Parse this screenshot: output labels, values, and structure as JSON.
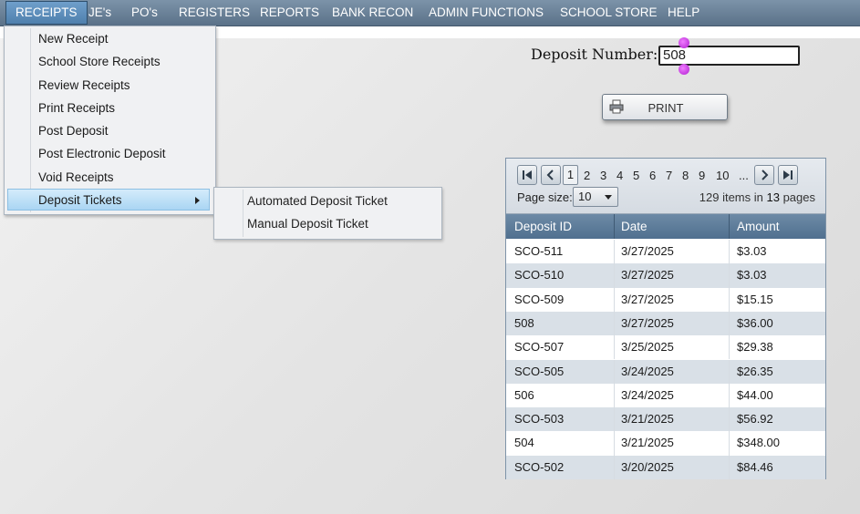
{
  "menubar": {
    "items": [
      "RECEIPTS",
      "JE's",
      "PO's",
      "REGISTERS",
      "REPORTS",
      "BANK RECON",
      "ADMIN FUNCTIONS",
      "SCHOOL STORE",
      "HELP"
    ]
  },
  "receipts_menu": {
    "items": [
      "New Receipt",
      "School Store Receipts",
      "Review Receipts",
      "Print Receipts",
      "Post Deposit",
      "Post Electronic Deposit",
      "Void Receipts",
      "Deposit Tickets"
    ],
    "highlighted": "Deposit Tickets"
  },
  "deposit_tickets_submenu": {
    "items": [
      "Automated Deposit Ticket",
      "Manual Deposit Ticket"
    ]
  },
  "deposit": {
    "label": "Deposit Number:",
    "value": "508"
  },
  "print_button": {
    "label": "PRINT",
    "icon": "printer-icon"
  },
  "pager": {
    "pages": [
      "1",
      "2",
      "3",
      "4",
      "5",
      "6",
      "7",
      "8",
      "9",
      "10",
      "..."
    ],
    "current": "1",
    "page_size_label": "Page size:",
    "page_size": "10",
    "items_count": "129",
    "items_text": "items in",
    "pages_count": "13",
    "pages_text": "pages"
  },
  "table": {
    "columns": [
      "Deposit ID",
      "Date",
      "Amount"
    ],
    "rows": [
      [
        "SCO-511",
        "3/27/2025",
        "$3.03"
      ],
      [
        "SCO-510",
        "3/27/2025",
        "$3.03"
      ],
      [
        "SCO-509",
        "3/27/2025",
        "$15.15"
      ],
      [
        "508",
        "3/27/2025",
        "$36.00"
      ],
      [
        "SCO-507",
        "3/25/2025",
        "$29.38"
      ],
      [
        "SCO-505",
        "3/24/2025",
        "$26.35"
      ],
      [
        "506",
        "3/24/2025",
        "$44.00"
      ],
      [
        "SCO-503",
        "3/21/2025",
        "$56.92"
      ],
      [
        "504",
        "3/21/2025",
        "$348.00"
      ],
      [
        "SCO-502",
        "3/20/2025",
        "$84.46"
      ]
    ]
  },
  "colors": {
    "menubar": "#5a7188",
    "menu_highlight": "#aad5f3",
    "grid_header": "#50708f",
    "row_alt": "#d9e0e7",
    "selection_handles": "#b01ed0"
  }
}
